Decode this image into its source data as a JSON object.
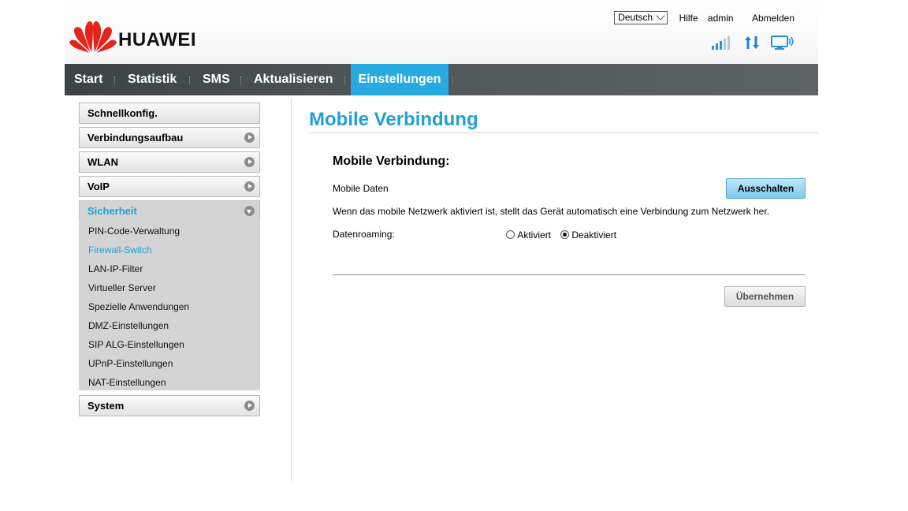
{
  "brand": {
    "name": "HUAWEI",
    "logo_color": "#e1251b"
  },
  "toplinks": {
    "language": "Deutsch",
    "help": "Hilfe",
    "user": "admin",
    "logout": "Abmelden"
  },
  "status_icons": [
    "signal-strength-icon",
    "data-transfer-icon",
    "monitor-connection-icon"
  ],
  "nav": {
    "items": [
      {
        "label": "Start"
      },
      {
        "label": "Statistik"
      },
      {
        "label": "SMS"
      },
      {
        "label": "Aktualisieren"
      },
      {
        "label": "Einstellungen",
        "active": true
      }
    ],
    "active_color": "#27a9e1"
  },
  "sidebar": {
    "sections": [
      {
        "label": "Schnellkonfig."
      },
      {
        "label": "Verbindungsaufbau"
      },
      {
        "label": "WLAN"
      },
      {
        "label": "VoIP"
      },
      {
        "label": "Sicherheit",
        "open": true
      },
      {
        "label": "System"
      }
    ],
    "security_items": [
      {
        "label": "PIN-Code-Verwaltung"
      },
      {
        "label": "Firewall-Switch",
        "active": true
      },
      {
        "label": "LAN-IP-Filter"
      },
      {
        "label": "Virtueller Server"
      },
      {
        "label": "Spezielle Anwendungen"
      },
      {
        "label": "DMZ-Einstellungen"
      },
      {
        "label": "SIP ALG-Einstellungen"
      },
      {
        "label": "UPnP-Einstellungen"
      },
      {
        "label": "NAT-Einstellungen"
      }
    ]
  },
  "content": {
    "title": "Mobile Verbindung",
    "section_title": "Mobile Verbindung:",
    "mobile_data_label": "Mobile Daten",
    "mobile_data_button": "Ausschalten",
    "info_text": "Wenn das mobile Netzwerk aktiviert ist, stellt das Gerät automatisch eine Verbindung zum Netzwerk her.",
    "roaming_label": "Datenroaming:",
    "roaming_options": [
      {
        "label": "Aktiviert",
        "selected": false
      },
      {
        "label": "Deaktiviert",
        "selected": true
      }
    ],
    "apply_button": "Übernehmen",
    "accent_color": "#239fd6"
  }
}
